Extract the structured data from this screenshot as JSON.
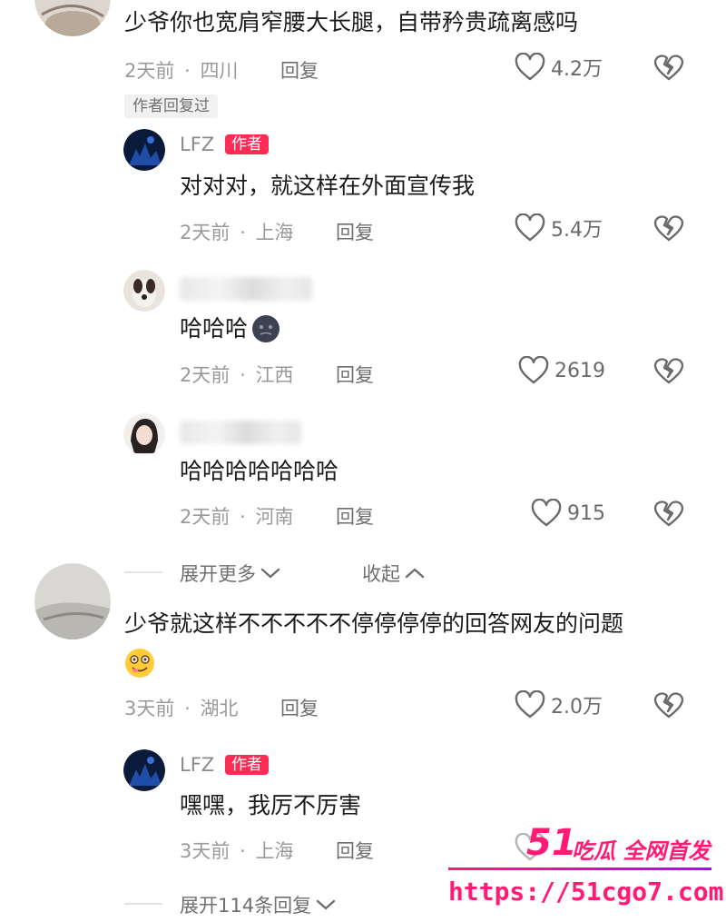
{
  "comments": [
    {
      "text": "少爷你也宽肩窄腰大长腿，自带矜贵疏离感吗",
      "time": "2天前",
      "location": "四川",
      "reply_label": "回复",
      "likes": "4.2万",
      "badge": "作者回复过"
    },
    {
      "text_line1": "少爷就这样不不不不不停停停停的回答网友的问题",
      "time": "3天前",
      "location": "湖北",
      "reply_label": "回复",
      "likes": "2.0万"
    }
  ],
  "replies": [
    {
      "name": "LFZ",
      "author_tag": "作者",
      "text": "对对对，就这样在外面宣传我",
      "time": "2天前",
      "location": "上海",
      "reply_label": "回复",
      "likes": "5.4万"
    },
    {
      "text": "哈哈哈",
      "time": "2天前",
      "location": "江西",
      "reply_label": "回复",
      "likes": "2619"
    },
    {
      "text": "哈哈哈哈哈哈哈",
      "time": "2天前",
      "location": "河南",
      "reply_label": "回复",
      "likes": "915"
    },
    {
      "name": "LFZ",
      "author_tag": "作者",
      "text": "嘿嘿，我厉不厉害",
      "time": "3天前",
      "location": "上海",
      "reply_label": "回复"
    }
  ],
  "thread_controls": {
    "expand_more": "展开更多",
    "collapse": "收起",
    "expand_replies": "展开114条回复"
  },
  "meta_separator": "·",
  "watermark": {
    "number": "51",
    "tagline": "吃瓜 全网首发",
    "url": "https://51cgo7.com"
  },
  "colors": {
    "author_tag": "#fe2c55",
    "watermark": "#ff1a75"
  }
}
